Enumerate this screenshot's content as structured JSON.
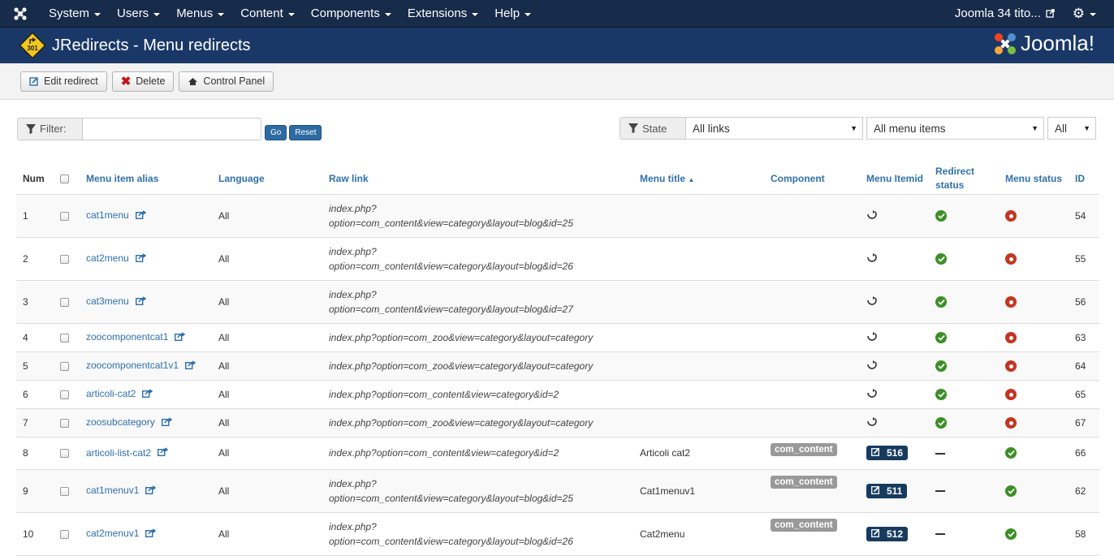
{
  "navbar": {
    "menus": [
      "System",
      "Users",
      "Menus",
      "Content",
      "Components",
      "Extensions",
      "Help"
    ],
    "site_name": "Joomla 34 tito..."
  },
  "header": {
    "badge_text": "301",
    "title": "JRedirects - Menu redirects",
    "brand": "Joomla!"
  },
  "toolbar": {
    "edit_label": "Edit redirect",
    "delete_label": "Delete",
    "control_panel_label": "Control Panel"
  },
  "filter": {
    "label": "Filter:",
    "value": "",
    "go_label": "Go",
    "reset_label": "Reset"
  },
  "state_filter": {
    "label": "State",
    "links_value": "All links",
    "menu_items_value": "All menu items",
    "all_value": "All"
  },
  "table": {
    "headers": {
      "num": "Num",
      "alias": "Menu item alias",
      "language": "Language",
      "raw_link": "Raw link",
      "menu_title": "Menu title",
      "component": "Component",
      "menu_itemid": "Menu Itemid",
      "redirect_status": "Redirect status",
      "menu_status": "Menu status",
      "id": "ID"
    },
    "rows": [
      {
        "num": "1",
        "alias": "cat1menu",
        "language": "All",
        "raw_link": [
          "index.php?",
          "option=com_content&view=category&layout=blog&id=25"
        ],
        "menu_title": "",
        "component": "",
        "itemid": "",
        "redirect": "ok",
        "menu_status": "off",
        "id": "54"
      },
      {
        "num": "2",
        "alias": "cat2menu",
        "language": "All",
        "raw_link": [
          "index.php?",
          "option=com_content&view=category&layout=blog&id=26"
        ],
        "menu_title": "",
        "component": "",
        "itemid": "",
        "redirect": "ok",
        "menu_status": "off",
        "id": "55"
      },
      {
        "num": "3",
        "alias": "cat3menu",
        "language": "All",
        "raw_link": [
          "index.php?",
          "option=com_content&view=category&layout=blog&id=27"
        ],
        "menu_title": "",
        "component": "",
        "itemid": "",
        "redirect": "ok",
        "menu_status": "off",
        "id": "56"
      },
      {
        "num": "4",
        "alias": "zoocomponentcat1",
        "language": "All",
        "raw_link": [
          "index.php?option=com_zoo&view=category&layout=category"
        ],
        "menu_title": "",
        "component": "",
        "itemid": "",
        "redirect": "ok",
        "menu_status": "off",
        "id": "63"
      },
      {
        "num": "5",
        "alias": "zoocomponentcat1v1",
        "language": "All",
        "raw_link": [
          "index.php?option=com_zoo&view=category&layout=category"
        ],
        "menu_title": "",
        "component": "",
        "itemid": "",
        "redirect": "ok",
        "menu_status": "off",
        "id": "64"
      },
      {
        "num": "6",
        "alias": "articoli-cat2",
        "language": "All",
        "raw_link": [
          "index.php?option=com_content&view=category&id=2"
        ],
        "menu_title": "",
        "component": "",
        "itemid": "",
        "redirect": "ok",
        "menu_status": "off",
        "id": "65"
      },
      {
        "num": "7",
        "alias": "zoosubcategory",
        "language": "All",
        "raw_link": [
          "index.php?option=com_zoo&view=category&layout=category"
        ],
        "menu_title": "",
        "component": "",
        "itemid": "",
        "redirect": "ok",
        "menu_status": "off",
        "id": "67"
      },
      {
        "num": "8",
        "alias": "articoli-list-cat2",
        "language": "All",
        "raw_link": [
          "index.php?option=com_content&view=category&id=2"
        ],
        "menu_title": "Articoli cat2",
        "component": "com_content",
        "itemid": "516",
        "redirect": "none",
        "menu_status": "ok",
        "id": "66"
      },
      {
        "num": "9",
        "alias": "cat1menuv1",
        "language": "All",
        "raw_link": [
          "index.php?",
          "option=com_content&view=category&layout=blog&id=25"
        ],
        "menu_title": "Cat1menuv1",
        "component": "com_content",
        "itemid": "511",
        "redirect": "none",
        "menu_status": "ok",
        "id": "62"
      },
      {
        "num": "10",
        "alias": "cat2menuv1",
        "language": "All",
        "raw_link": [
          "index.php?",
          "option=com_content&view=category&layout=blog&id=26"
        ],
        "menu_title": "Cat2menu",
        "component": "com_content",
        "itemid": "512",
        "redirect": "none",
        "menu_status": "ok",
        "id": "58"
      }
    ]
  }
}
